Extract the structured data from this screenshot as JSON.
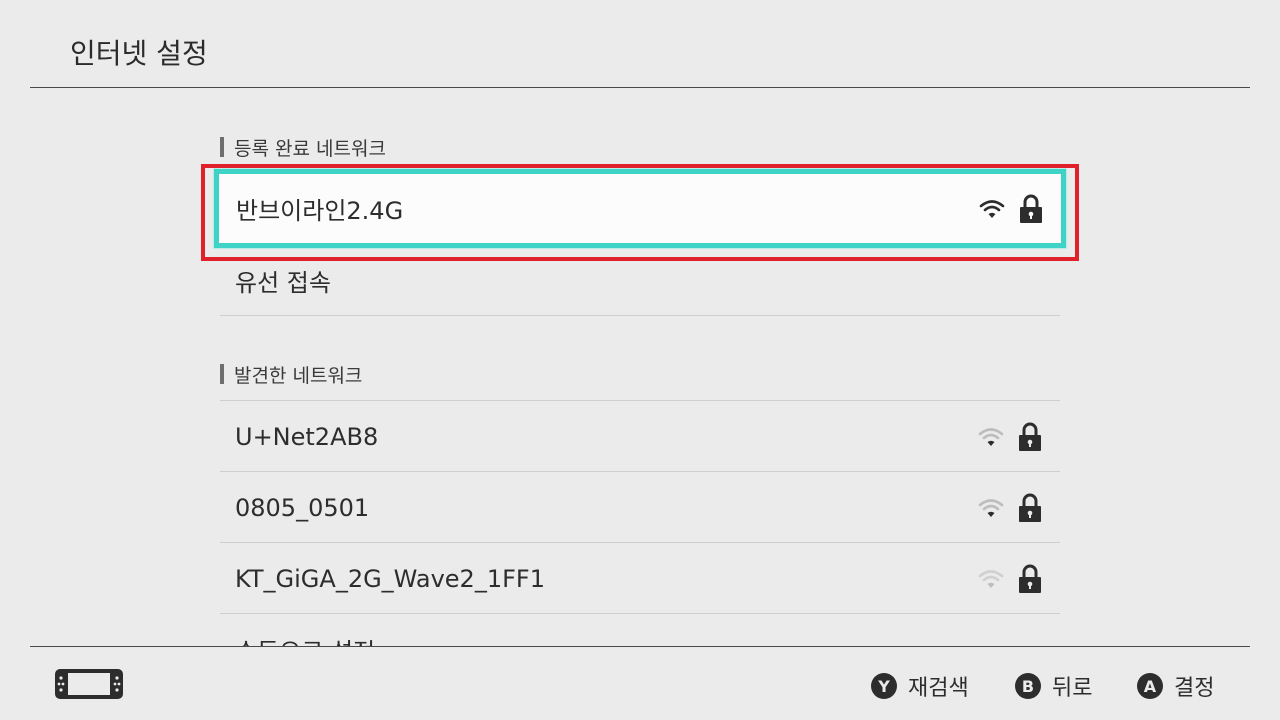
{
  "header": {
    "title": "인터넷 설정"
  },
  "registered": {
    "label": "등록 완료 네트워크",
    "selected_network": {
      "name": "반브이라인2.4G",
      "signal_icon": "wifi-strong-icon",
      "secured": true
    },
    "wired_label": "유선 접속"
  },
  "found": {
    "label": "발견한 네트워크",
    "networks": [
      {
        "name": "U+Net2AB8",
        "signal_icon": "wifi-weak-icon",
        "secured": true
      },
      {
        "name": "0805_0501",
        "signal_icon": "wifi-weak-icon",
        "secured": true
      },
      {
        "name": "KT_GiGA_2G_Wave2_1FF1",
        "signal_icon": "wifi-weak-icon",
        "secured": true
      }
    ],
    "manual_label": "수동으로 설정"
  },
  "footer": {
    "console_icon": "handheld-console-icon",
    "buttons": [
      {
        "key": "Y",
        "label": "재검색"
      },
      {
        "key": "B",
        "label": "뒤로"
      },
      {
        "key": "A",
        "label": "결정"
      }
    ]
  },
  "colors": {
    "background": "#ebebeb",
    "selection_cyan": "#3fd2c7",
    "highlight_red": "#e0202a",
    "text": "#2d2d2d"
  }
}
